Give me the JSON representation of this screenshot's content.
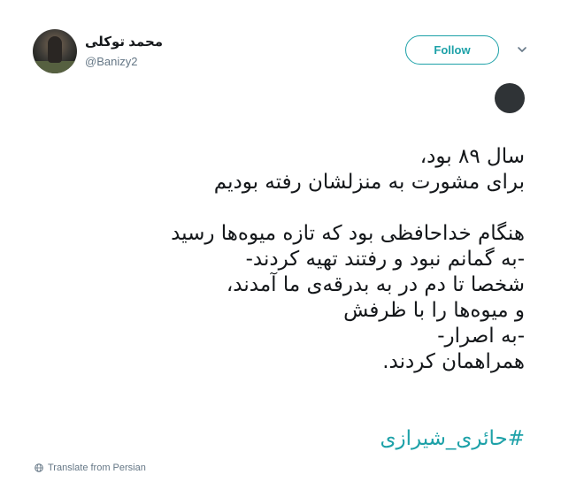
{
  "user": {
    "name": "محمد توکلی",
    "handle": "@Banizy2"
  },
  "actions": {
    "follow_label": "Follow"
  },
  "tweet": {
    "lines": [
      "سال ۸۹ بود،",
      "برای مشورت به منزلشان رفته بودیم",
      "",
      "هنگام خداحافظی بود که تازه میوه‌ها رسید",
      "-به گمانم نبود و رفتند تهیه کردند-",
      "شخصا تا دم در به بدرقه‌ی ما آمدند،",
      "و میوه‌ها را با ظرفش",
      "-به اصرار-",
      "همراهمان کردند."
    ],
    "hashtag": "#حائری_شیرازی"
  },
  "footer": {
    "translate_label": "Translate from Persian"
  },
  "icons": {
    "chevron": "chevron-down-icon",
    "emoji": "black-circle-emoji",
    "globe": "globe-icon"
  },
  "colors": {
    "accent": "#1da1a8",
    "text": "#14171a",
    "muted": "#657786"
  }
}
